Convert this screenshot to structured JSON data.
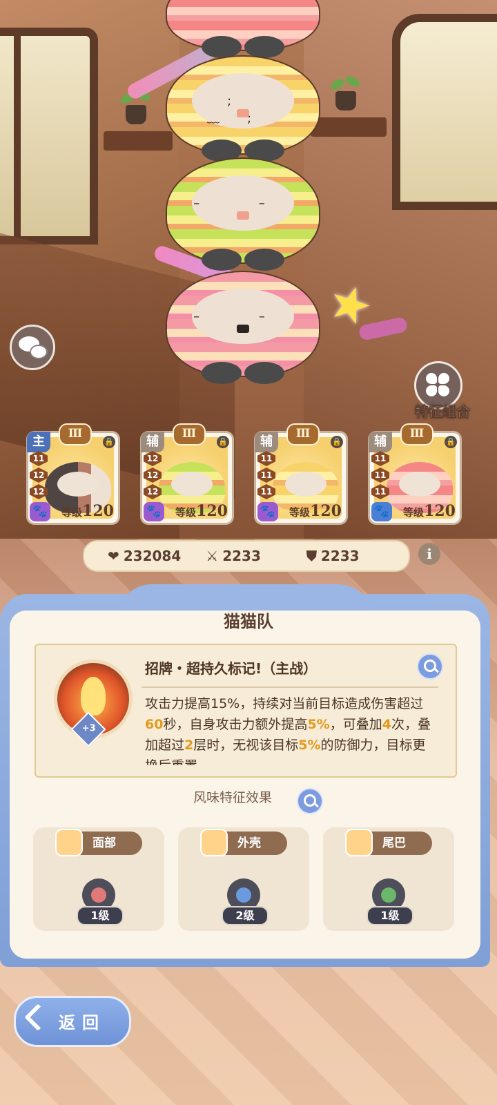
{
  "stats": {
    "hp": "232084",
    "attack": "2233",
    "defense": "2233"
  },
  "buttons": {
    "combo_label": "特征组合",
    "back_label": "返回"
  },
  "cards": [
    {
      "role": "主",
      "tier": "Ⅲ",
      "levels": [
        "11",
        "12",
        "12"
      ],
      "level_prefix": "等级",
      "level": "120",
      "paw_color": "#9b5bd0"
    },
    {
      "role": "辅",
      "tier": "Ⅲ",
      "levels": [
        "12",
        "12",
        "12"
      ],
      "level_prefix": "等级",
      "level": "120",
      "paw_color": "#9b5bd0"
    },
    {
      "role": "辅",
      "tier": "Ⅲ",
      "levels": [
        "11",
        "11",
        "11"
      ],
      "level_prefix": "等级",
      "level": "120",
      "paw_color": "#9b5bd0"
    },
    {
      "role": "辅",
      "tier": "Ⅲ",
      "levels": [
        "11",
        "11",
        "11"
      ],
      "level_prefix": "等级",
      "level": "120",
      "paw_color": "#4a7fd6"
    }
  ],
  "panel": {
    "title": "猫猫队",
    "skill": {
      "name": "招牌・超持久标记!（主战）",
      "badge": "+3",
      "desc_parts": [
        "攻击力提高15%，持续对当前目标造成伤害超过",
        "60",
        "秒，自身攻击力额外提高",
        "5%",
        "，可叠加",
        "4",
        "次，叠加超过",
        "2",
        "层时，无视该目标",
        "5%",
        "的防御力，目标更换后重置"
      ]
    },
    "flavor_title": "风味特征效果",
    "traits": [
      {
        "name": "面部",
        "level": "1级",
        "gem_color": "#e07a7a"
      },
      {
        "name": "外壳",
        "level": "2级",
        "gem_color": "#6a9be0"
      },
      {
        "name": "尾巴",
        "level": "1级",
        "gem_color": "#6ab86a"
      }
    ]
  }
}
